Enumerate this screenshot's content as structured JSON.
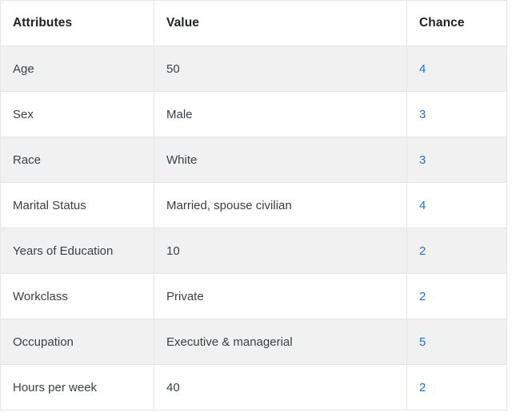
{
  "table": {
    "columns": [
      {
        "key": "attribute",
        "label": "Attributes"
      },
      {
        "key": "value",
        "label": "Value"
      },
      {
        "key": "chance",
        "label": "Chance"
      }
    ],
    "rows": [
      {
        "attribute": "Age",
        "value": "50",
        "chance": "4"
      },
      {
        "attribute": "Sex",
        "value": "Male",
        "chance": "3"
      },
      {
        "attribute": "Race",
        "value": "White",
        "chance": "3"
      },
      {
        "attribute": "Marital Status",
        "value": "Married, spouse civilian",
        "chance": "4"
      },
      {
        "attribute": "Years of Education",
        "value": "10",
        "chance": "2"
      },
      {
        "attribute": "Workclass",
        "value": "Private",
        "chance": "2"
      },
      {
        "attribute": "Occupation",
        "value": "Executive & managerial",
        "chance": "5"
      },
      {
        "attribute": "Hours per week",
        "value": "40",
        "chance": "2"
      }
    ],
    "colors": {
      "chance_text": "#1a73e8",
      "header_text": "#1f2023",
      "body_text": "#3c4043",
      "row_shaded_bg": "#f1f1f2",
      "row_plain_bg": "#ffffff",
      "border": "#e3e5e9"
    }
  }
}
